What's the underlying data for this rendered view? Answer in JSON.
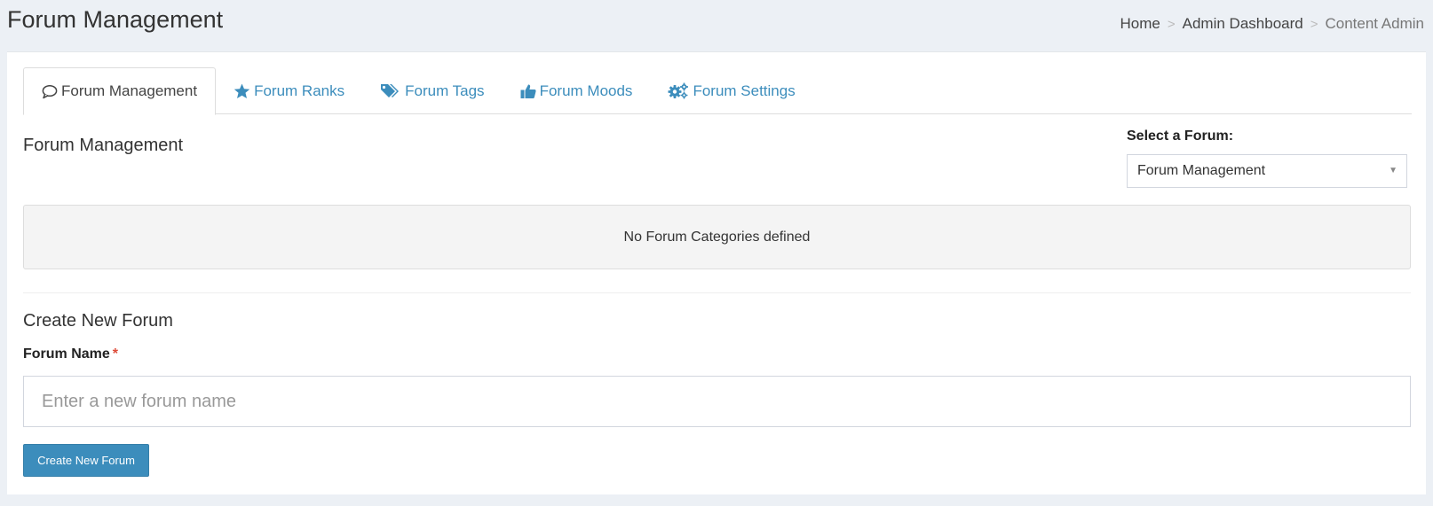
{
  "page": {
    "title": "Forum Management"
  },
  "breadcrumb": {
    "items": [
      "Home",
      "Admin Dashboard",
      "Content Admin"
    ],
    "separator": ">"
  },
  "tabs": [
    {
      "label": "Forum Management",
      "icon": "comment-icon",
      "active": true
    },
    {
      "label": "Forum Ranks",
      "icon": "star-icon",
      "active": false
    },
    {
      "label": "Forum Tags",
      "icon": "tags-icon",
      "active": false
    },
    {
      "label": "Forum Moods",
      "icon": "thumbs-up-icon",
      "active": false
    },
    {
      "label": "Forum Settings",
      "icon": "cogs-icon",
      "active": false
    }
  ],
  "management": {
    "title": "Forum Management",
    "select_label": "Select a Forum:",
    "selected_forum": "Forum Management",
    "empty_message": "No Forum Categories defined"
  },
  "create": {
    "title": "Create New Forum",
    "name_label": "Forum Name",
    "required_marker": "*",
    "name_placeholder": "Enter a new forum name",
    "name_value": "",
    "button_label": "Create New Forum"
  },
  "colors": {
    "accent": "#3c8dbc",
    "background": "#ecf0f5",
    "required": "#dd4b39"
  }
}
